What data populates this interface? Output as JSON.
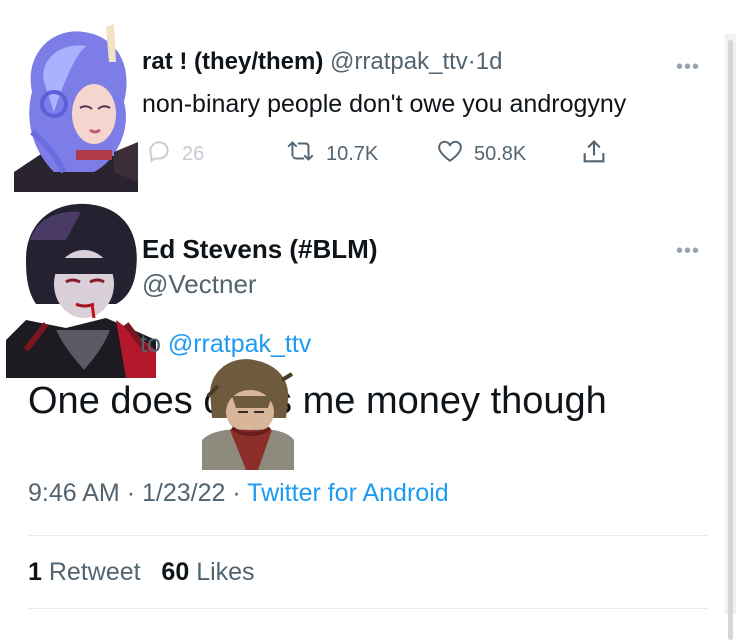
{
  "tweet1": {
    "display_name": "rat ! (they/them)",
    "handle": "@rratpak_ttv",
    "separator": "·",
    "time": "1d",
    "body": "non-binary people don't owe you androgyny",
    "replies": "26",
    "retweets": "10.7K",
    "likes": "50.8K",
    "more_glyph": "•••"
  },
  "tweet2": {
    "display_name": "Ed Stevens (#BLM)",
    "handle": "@Vectner",
    "replying_prefix": "to",
    "replying_handle": "@rratpak_ttv",
    "body": "One does owes me money though",
    "time": "9:46 AM",
    "date": "1/23/22",
    "sep": "·",
    "source": "Twitter for Android",
    "retweet_count": "1",
    "retweet_label": "Retweet",
    "like_count": "60",
    "like_label": "Likes",
    "more_glyph": "•••"
  },
  "colors": {
    "text": "#0f1419",
    "muted": "#536471",
    "link": "#1d9bf0"
  },
  "icons": [
    "reply-icon",
    "retweet-icon",
    "like-icon",
    "share-icon",
    "more-icon"
  ]
}
